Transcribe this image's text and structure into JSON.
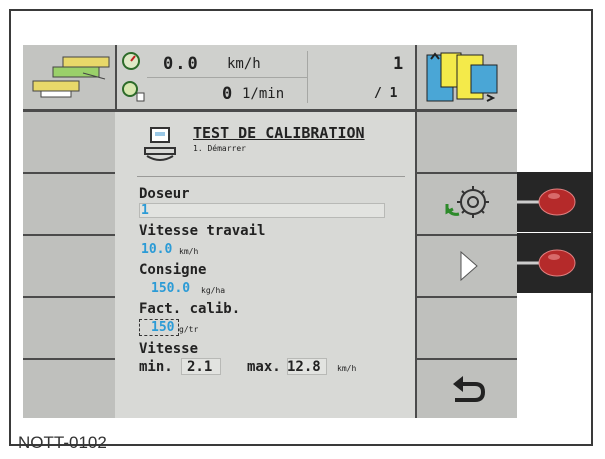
{
  "caption": "NOTT-0102",
  "topbar": {
    "speed_value": "0.0",
    "speed_unit": "km/h",
    "rpm_value": "0",
    "rpm_unit": "1/min",
    "counter_top": "1",
    "counter_bottom": "/ 1"
  },
  "panel": {
    "title": "TEST DE CALIBRATION",
    "subtitle": "1. Démarrer",
    "fields": {
      "doseur_label": "Doseur",
      "doseur_value": "1",
      "vitesse_travail_label": "Vitesse travail",
      "vitesse_travail_value": "10.0",
      "vitesse_travail_unit": "km/h",
      "consigne_label": "Consigne",
      "consigne_value": "150.0",
      "consigne_unit": "kg/ha",
      "fact_calib_label": "Fact. calib.",
      "fact_calib_value": "150",
      "fact_calib_unit": "g/tr",
      "vitesse_label": "Vitesse",
      "min_label": "min.",
      "min_value": "2.1",
      "max_label": "max.",
      "max_value": "12.8",
      "max_unit": "km/h"
    }
  },
  "icons": {
    "machine": "machine-config-icon",
    "speedometer": "speedometer-icon",
    "rpm": "rotation-sensor-icon",
    "section": "section-control-icon",
    "calib": "calibration-scale-icon",
    "rotate": "rotate-metering-icon",
    "next": "next-arrow-icon",
    "back": "back-return-icon"
  },
  "colors": {
    "value_blue": "#2b9bd6",
    "knob_red": "#b52a2a"
  }
}
